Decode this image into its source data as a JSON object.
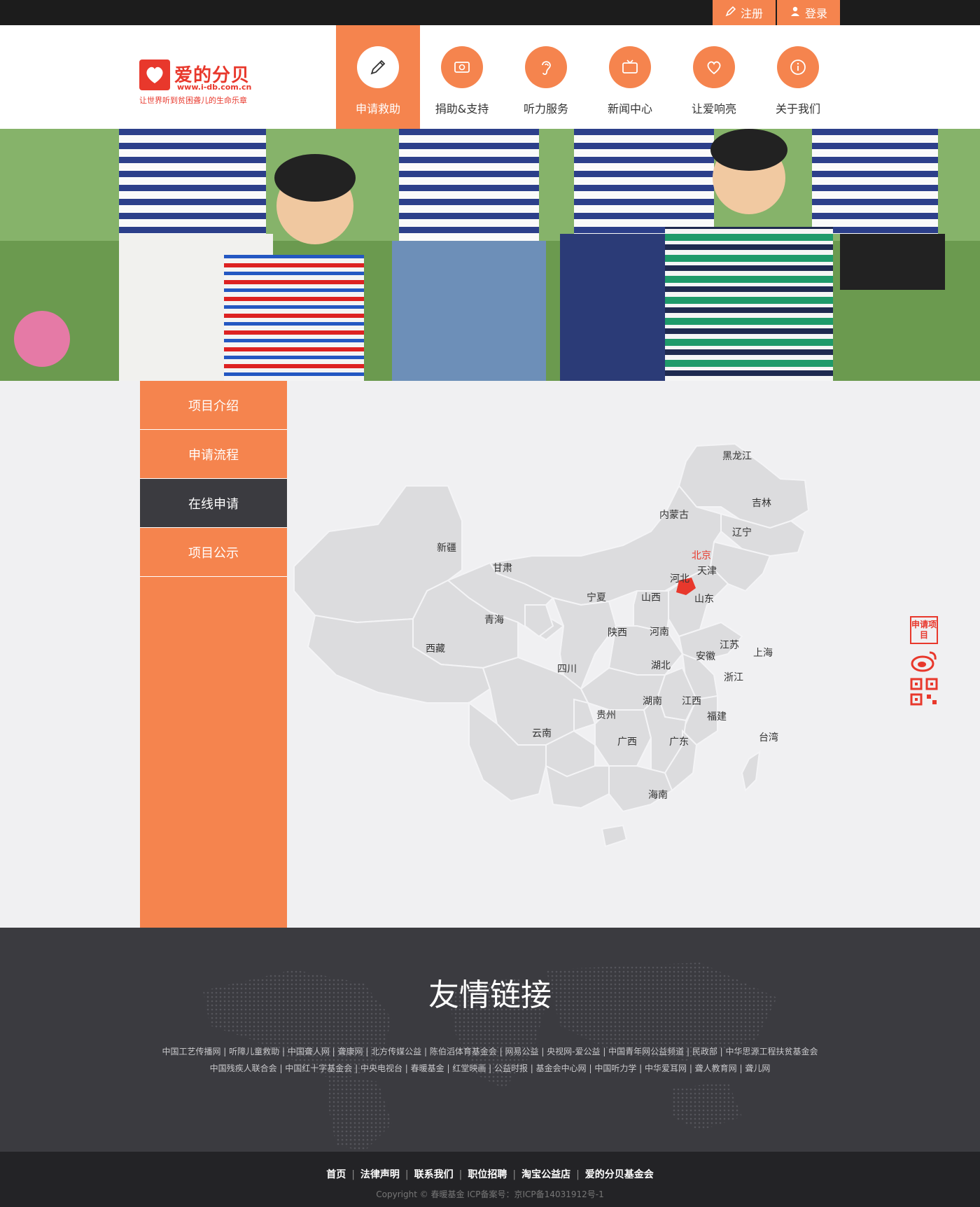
{
  "auth": {
    "register": "注册",
    "login": "登录"
  },
  "logo": {
    "name": "爱的分贝",
    "url": "www.i-db.com.cn",
    "slogan": "让世界听到贫困聋儿的生命乐章"
  },
  "nav": [
    {
      "label": "申请救助",
      "icon": "pencil-icon"
    },
    {
      "label": "捐助&支持",
      "icon": "money-icon"
    },
    {
      "label": "听力服务",
      "icon": "ear-icon"
    },
    {
      "label": "新闻中心",
      "icon": "tv-icon"
    },
    {
      "label": "让爱响亮",
      "icon": "heart-icon"
    },
    {
      "label": "关于我们",
      "icon": "info-icon"
    }
  ],
  "sidebar": [
    {
      "label": "项目介绍"
    },
    {
      "label": "申请流程"
    },
    {
      "label": "在线申请"
    },
    {
      "label": "项目公示"
    }
  ],
  "map": {
    "highlight_color": "#e8382c",
    "provinces": {
      "heilongjiang": "黑龙江",
      "jilin": "吉林",
      "liaoning": "辽宁",
      "neimenggu": "内蒙古",
      "beijing": "北京",
      "tianjin": "天津",
      "hebei": "河北",
      "shanxi": "山西",
      "shandong": "山东",
      "xinjiang": "新疆",
      "gansu": "甘肃",
      "ningxia": "宁夏",
      "qinghai": "青海",
      "xizang": "西藏",
      "shaanxi": "陕西",
      "henan": "河南",
      "jiangsu": "江苏",
      "shanghai": "上海",
      "anhui": "安徽",
      "hubei": "湖北",
      "zhejiang": "浙江",
      "sichuan": "四川",
      "hunan": "湖南",
      "jiangxi": "江西",
      "guizhou": "贵州",
      "fujian": "福建",
      "yunnan": "云南",
      "guangxi": "广西",
      "guangdong": "广东",
      "taiwan": "台湾",
      "hainan": "海南"
    }
  },
  "float": {
    "apply": "申请项目"
  },
  "footer": {
    "title": "友情链接",
    "links_line1": "中国工艺传播网 | 听障儿童救助 | 中国聋人网 | 聋康网 | 北方传媒公益 | 陈伯滔体育基金会 | 网易公益 | 央视网-爱公益 | 中国青年网公益频道 | 民政部 | 中华思源工程扶贫基金会",
    "links_line2": "中国残疾人联合会 | 中国红十字基金会 | 中央电视台 | 春暖基金 | 红堂映画 | 公益时报 | 基金会中心网 | 中国听力学 | 中华爱耳网 | 聋人教育网 | 聋儿网"
  },
  "bottom": {
    "links": [
      "首页",
      "法律声明",
      "联系我们",
      "职位招聘",
      "淘宝公益店",
      "爱的分贝基金会"
    ],
    "copyright": "Copyright © 春暖基金 ICP备案号：京ICP备14031912号-1"
  }
}
